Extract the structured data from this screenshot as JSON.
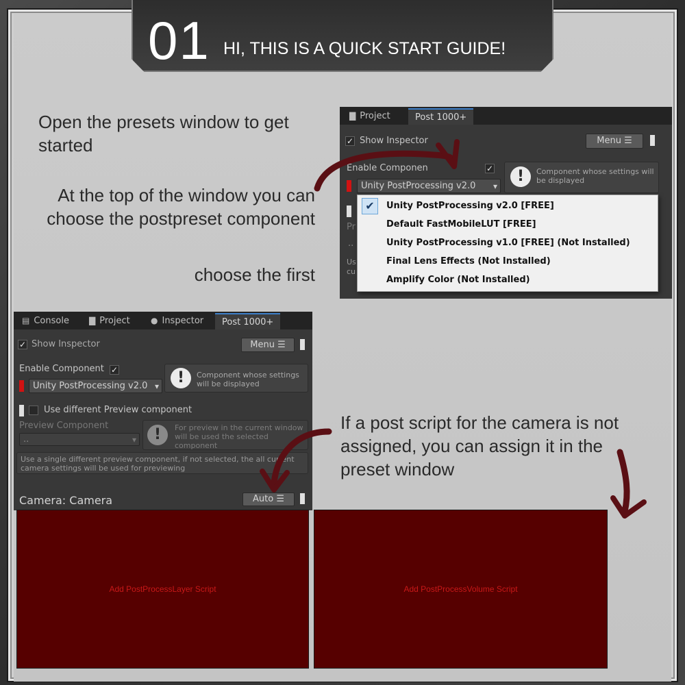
{
  "header": {
    "number": "01",
    "title": "HI, THIS IS A QUICK START GUIDE!"
  },
  "instructions": {
    "open_presets": "Open the presets window to get started",
    "choose_component": "At the top of the window you can choose the postpreset component",
    "choose_first": "choose the first",
    "assign_script": "If a post script for the camera is not assigned, you can assign it in the preset window"
  },
  "top_panel": {
    "tabs": [
      {
        "label": "Project",
        "icon": "folder-icon"
      },
      {
        "label": "Post 1000+"
      }
    ],
    "show_inspector": "Show Inspector",
    "menu_button": "Menu ☰",
    "enable_component": "Enable Componen",
    "selected_component": "Unity PostProcessing v2.0",
    "info_text": "Component whose settings will be displayed",
    "hidden_pr": "Pr",
    "hidden_dots": "..",
    "hidden_us": "Us",
    "hidden_cu": "cu",
    "dropdown_items": [
      "Unity PostProcessing v2.0 [FREE]",
      "Default FastMobileLUT [FREE]",
      "Unity PostProcessing v1.0 [FREE]  (Not Installed)",
      "Final Lens Effects  (Not Installed)",
      "Amplify Color  (Not Installed)"
    ]
  },
  "bottom_panel": {
    "tabs": [
      {
        "label": "Console",
        "icon": "console-icon"
      },
      {
        "label": "Project",
        "icon": "folder-icon"
      },
      {
        "label": "Inspector",
        "icon": "info-icon"
      },
      {
        "label": "Post 1000+"
      }
    ],
    "show_inspector": "Show Inspector",
    "menu_button": "Menu ☰",
    "enable_component": "Enable Component",
    "selected_component": "Unity PostProcessing v2.0",
    "info_text": "Component whose settings will be displayed",
    "use_different": "Use different Preview component",
    "preview_component_label": "Preview Component",
    "preview_value": "..",
    "preview_info": "For preview in the current window will be used the selected component",
    "single_preview_note": "Use a single different preview component, if not selected, the all current camera settings will be used for previewing",
    "camera_label": "Camera: Camera",
    "auto_button": "Auto ☰",
    "add_layer": "Add PostProcessLayer Script",
    "add_volume": "Add PostProcessVolume Script"
  },
  "colors": {
    "accent_red": "#d11212",
    "script_bg": "#560000",
    "arrow": "#5a0f14"
  }
}
